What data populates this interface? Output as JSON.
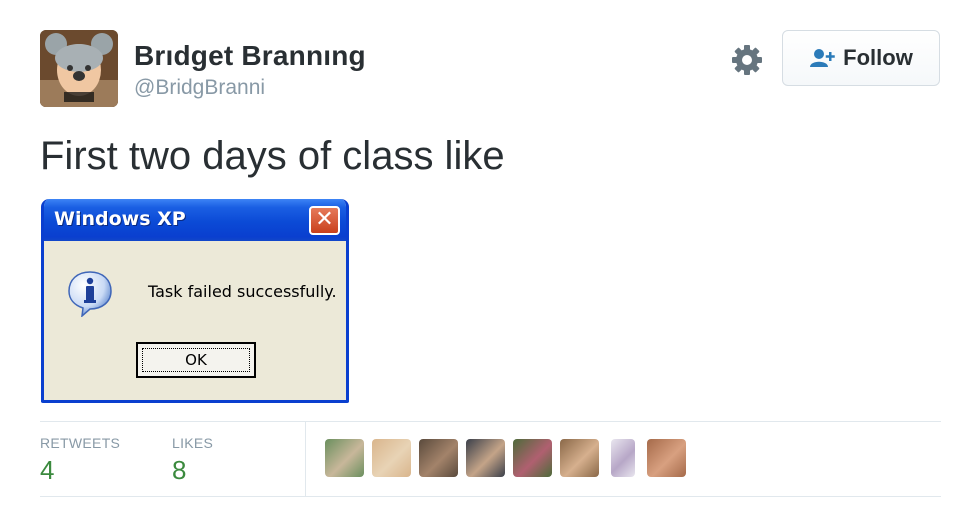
{
  "author": {
    "name": "Brıdget Brannıng",
    "handle": "@BridgBranni"
  },
  "follow_button": {
    "label": "Follow"
  },
  "tweet": {
    "text": "First two days of class like"
  },
  "dialog": {
    "title": "Windows XP",
    "close_glyph": "✕",
    "message": "Task failed successfully.",
    "ok_label": "OK"
  },
  "stats": {
    "retweets_label": "RETWEETS",
    "retweets_count": "4",
    "likes_label": "LIKES",
    "likes_count": "8"
  },
  "likers": [
    {
      "colors": [
        "#6a8f5e",
        "#c8b79a"
      ]
    },
    {
      "colors": [
        "#d9b58c",
        "#e8d3b5"
      ]
    },
    {
      "colors": [
        "#5a4a3c",
        "#a3836a"
      ]
    },
    {
      "colors": [
        "#3a3f4a",
        "#c4a488"
      ]
    },
    {
      "colors": [
        "#4d6b3a",
        "#b06070"
      ]
    },
    {
      "colors": [
        "#8a6848",
        "#d6b08e"
      ]
    },
    {
      "colors": [
        "#e9e6ef",
        "#b7a7c7"
      ]
    },
    {
      "colors": [
        "#a56a4a",
        "#d8a080"
      ]
    }
  ],
  "colors": {
    "stat_value": "#3b8a3e",
    "follow_icon": "#2b7bb9",
    "xp_titlebar": "#0a3fcf"
  }
}
